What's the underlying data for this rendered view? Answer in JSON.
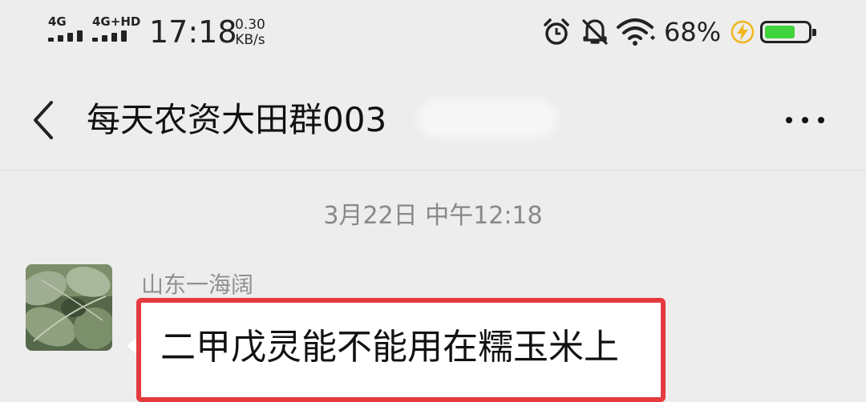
{
  "status": {
    "sim1": "4G",
    "sim2": "4G+HD",
    "time": "17:18",
    "speed_value": "0.30",
    "speed_unit": "KB/s",
    "battery": "68%",
    "icons": [
      "alarm-icon",
      "mute-icon",
      "wifi-icon",
      "charging-icon",
      "battery-icon"
    ],
    "battery_color": "#41d33c"
  },
  "header": {
    "back_icon": "chevron-left-icon",
    "title": "每天农资大田群003",
    "more_icon": "more-icon"
  },
  "chat": {
    "timestamp": "3月22日 中午12:18",
    "messages": [
      {
        "sender": "山东一海阔",
        "text": "二甲戊灵能不能用在糯玉米上"
      }
    ]
  },
  "colors": {
    "background": "#ededed",
    "highlight_border": "#e53a3f",
    "bubble": "#ffffff"
  }
}
